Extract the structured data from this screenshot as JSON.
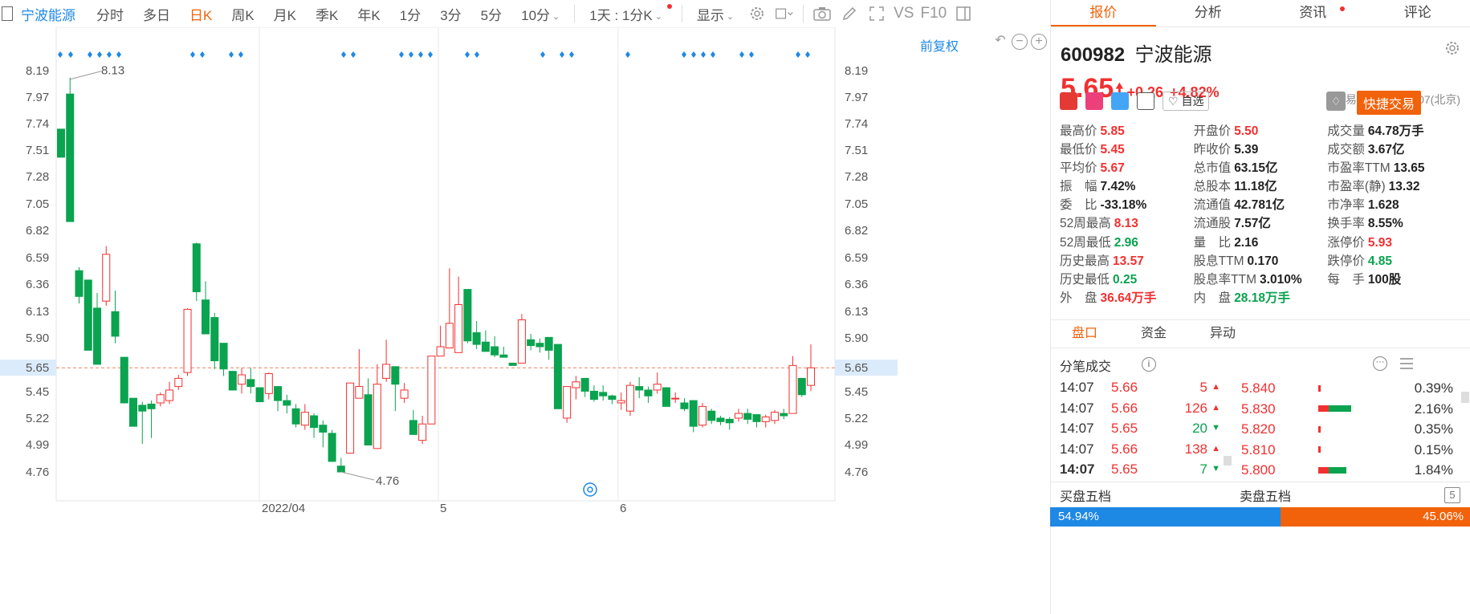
{
  "toolbar": {
    "stock_name": "宁波能源",
    "periods": [
      "分时",
      "多日",
      "日K",
      "周K",
      "月K",
      "季K",
      "年K",
      "1分",
      "3分",
      "5分",
      "10分"
    ],
    "active_period": "日K",
    "multi_day": "1天 : 1分K",
    "display_label": "显示",
    "vs_label": "VS",
    "f10_label": "F10"
  },
  "chart": {
    "adjust_label": "前复权",
    "y_ticks": [
      "8.19",
      "7.97",
      "7.74",
      "7.51",
      "7.28",
      "7.05",
      "6.82",
      "6.59",
      "6.36",
      "6.13",
      "5.90",
      "5.65",
      "5.45",
      "5.22",
      "4.99",
      "4.76"
    ],
    "current_price_tag": "5.65",
    "x_labels": [
      "2022/04",
      "5",
      "6"
    ],
    "high_annotation": "8.13",
    "low_annotation": "4.76",
    "up_color": "#f23030",
    "down_color": "#0aa34f"
  },
  "chart_data": {
    "type": "candlestick",
    "y_axis_ticks": [
      8.19,
      7.97,
      7.74,
      7.51,
      7.28,
      7.05,
      6.82,
      6.59,
      6.36,
      6.13,
      5.9,
      5.65,
      5.45,
      5.22,
      4.99,
      4.76
    ],
    "ylim": [
      4.6,
      8.36
    ],
    "x_tick_labels": [
      "2022/04",
      "5",
      "6"
    ],
    "max_label": 8.13,
    "min_label": 4.76,
    "candles": [
      [
        7.69,
        7.45,
        7.69,
        7.45
      ],
      [
        7.99,
        6.9,
        8.13,
        6.9
      ],
      [
        6.48,
        6.26,
        6.51,
        6.2
      ],
      [
        6.4,
        5.8,
        6.4,
        5.8
      ],
      [
        6.16,
        5.68,
        6.29,
        5.68
      ],
      [
        6.22,
        6.62,
        6.69,
        6.18
      ],
      [
        6.13,
        5.92,
        6.31,
        5.86
      ],
      [
        5.74,
        5.35,
        5.74,
        5.35
      ],
      [
        5.39,
        5.15,
        5.39,
        5.15
      ],
      [
        5.33,
        5.28,
        5.36,
        5.0
      ],
      [
        5.34,
        5.3,
        5.37,
        5.05
      ],
      [
        5.35,
        5.42,
        5.44,
        5.32
      ],
      [
        5.37,
        5.46,
        5.53,
        5.34
      ],
      [
        5.49,
        5.56,
        5.59,
        5.46
      ],
      [
        5.61,
        6.15,
        6.16,
        5.58
      ],
      [
        6.71,
        6.3,
        6.72,
        6.22
      ],
      [
        6.23,
        5.94,
        6.39,
        5.94
      ],
      [
        6.08,
        5.71,
        6.12,
        5.64
      ],
      [
        5.86,
        5.64,
        5.86,
        5.58
      ],
      [
        5.62,
        5.46,
        5.62,
        5.46
      ],
      [
        5.51,
        5.59,
        5.65,
        5.43
      ],
      [
        5.55,
        5.49,
        5.65,
        5.43
      ],
      [
        5.48,
        5.36,
        5.48,
        5.36
      ],
      [
        5.43,
        5.6,
        5.61,
        5.38
      ],
      [
        5.49,
        5.37,
        5.49,
        5.28
      ],
      [
        5.37,
        5.33,
        5.42,
        5.26
      ],
      [
        5.3,
        5.17,
        5.34,
        5.14
      ],
      [
        5.16,
        5.27,
        5.34,
        5.12
      ],
      [
        5.24,
        5.14,
        5.26,
        5.05
      ],
      [
        5.16,
        5.1,
        5.2,
        4.97
      ],
      [
        5.09,
        4.85,
        5.12,
        4.85
      ],
      [
        4.81,
        4.76,
        4.88,
        4.76
      ],
      [
        4.92,
        5.52,
        5.52,
        4.92
      ],
      [
        5.39,
        5.49,
        5.81,
        5.39
      ],
      [
        5.42,
        4.99,
        5.56,
        4.99
      ],
      [
        4.96,
        5.51,
        5.68,
        4.96
      ],
      [
        5.56,
        5.68,
        5.89,
        5.53
      ],
      [
        5.66,
        5.51,
        5.66,
        5.28
      ],
      [
        5.39,
        5.46,
        5.52,
        5.35
      ],
      [
        5.2,
        5.08,
        5.29,
        5.08
      ],
      [
        5.03,
        5.17,
        5.24,
        5.0
      ],
      [
        5.17,
        5.75,
        5.75,
        5.17
      ],
      [
        5.75,
        5.83,
        6.01,
        5.75
      ],
      [
        5.82,
        6.03,
        6.5,
        5.82
      ],
      [
        5.78,
        6.19,
        6.43,
        5.78
      ],
      [
        6.32,
        5.88,
        6.32,
        5.86
      ],
      [
        5.95,
        5.85,
        6.05,
        5.81
      ],
      [
        5.87,
        5.79,
        5.97,
        5.79
      ],
      [
        5.83,
        5.76,
        5.92,
        5.74
      ],
      [
        5.76,
        5.74,
        5.83,
        5.74
      ],
      [
        5.69,
        5.67,
        5.69,
        5.67
      ],
      [
        5.69,
        6.06,
        6.11,
        5.69
      ],
      [
        5.89,
        5.84,
        5.94,
        5.8
      ],
      [
        5.86,
        5.83,
        5.9,
        5.78
      ],
      [
        5.91,
        5.8,
        5.91,
        5.72
      ],
      [
        5.85,
        5.3,
        5.85,
        5.3
      ],
      [
        5.22,
        5.49,
        5.49,
        5.18
      ],
      [
        5.48,
        5.53,
        5.58,
        5.38
      ],
      [
        5.56,
        5.45,
        5.56,
        5.4
      ],
      [
        5.45,
        5.38,
        5.5,
        5.36
      ],
      [
        5.44,
        5.41,
        5.5,
        5.37
      ],
      [
        5.41,
        5.38,
        5.42,
        5.34
      ],
      [
        5.35,
        5.37,
        5.44,
        5.29
      ],
      [
        5.28,
        5.5,
        5.53,
        5.24
      ],
      [
        5.49,
        5.46,
        5.57,
        5.39
      ],
      [
        5.46,
        5.41,
        5.49,
        5.35
      ],
      [
        5.46,
        5.51,
        5.61,
        5.43
      ],
      [
        5.48,
        5.32,
        5.48,
        5.32
      ],
      [
        5.39,
        5.39,
        5.44,
        5.35
      ],
      [
        5.35,
        5.3,
        5.39,
        5.28
      ],
      [
        5.37,
        5.15,
        5.37,
        5.1
      ],
      [
        5.16,
        5.32,
        5.35,
        5.14
      ],
      [
        5.28,
        5.2,
        5.3,
        5.17
      ],
      [
        5.22,
        5.19,
        5.24,
        5.16
      ],
      [
        5.21,
        5.18,
        5.23,
        5.12
      ],
      [
        5.22,
        5.26,
        5.3,
        5.19
      ],
      [
        5.26,
        5.21,
        5.3,
        5.17
      ],
      [
        5.25,
        5.19,
        5.25,
        5.14
      ],
      [
        5.19,
        5.23,
        5.25,
        5.14
      ],
      [
        5.2,
        5.27,
        5.29,
        5.17
      ],
      [
        5.26,
        5.24,
        5.3,
        5.21
      ],
      [
        5.26,
        5.67,
        5.75,
        5.26
      ],
      [
        5.56,
        5.42,
        5.56,
        5.4
      ],
      [
        5.5,
        5.65,
        5.85,
        5.45
      ]
    ]
  },
  "panel": {
    "tabs": [
      "报价",
      "分析",
      "资讯",
      "评论"
    ],
    "active_tab": "报价",
    "code": "600982",
    "name": "宁波能源",
    "price": "5.65",
    "change": "+0.26",
    "pct": "+4.82%",
    "status": "交易中 06/30 14:07(北京)",
    "watch_label": "自选",
    "quick_trade": "快捷交易",
    "stats": [
      [
        [
          "最高价",
          "5.85",
          "red"
        ],
        [
          "开盘价",
          "5.50",
          "red"
        ],
        [
          "成交量",
          "64.78万手",
          "dark"
        ]
      ],
      [
        [
          "最低价",
          "5.45",
          "red"
        ],
        [
          "昨收价",
          "5.39",
          "dark"
        ],
        [
          "成交额",
          "3.67亿",
          "dark"
        ]
      ],
      [
        [
          "平均价",
          "5.67",
          "red"
        ],
        [
          "总市值",
          "63.15亿",
          "dark"
        ],
        [
          "市盈率TTM",
          "13.65",
          "dark"
        ]
      ],
      [
        [
          "振　幅",
          "7.42%",
          "dark"
        ],
        [
          "总股本",
          "11.18亿",
          "dark"
        ],
        [
          "市盈率(静)",
          "13.32",
          "dark"
        ]
      ],
      [
        [
          "委　比",
          "-33.18%",
          "dark"
        ],
        [
          "流通值",
          "42.781亿",
          "dark"
        ],
        [
          "市净率",
          "1.628",
          "dark"
        ]
      ],
      [
        [
          "52周最高",
          "8.13",
          "red"
        ],
        [
          "流通股",
          "7.57亿",
          "dark"
        ],
        [
          "换手率",
          "8.55%",
          "dark"
        ]
      ],
      [
        [
          "52周最低",
          "2.96",
          "green"
        ],
        [
          "量　比",
          "2.16",
          "dark"
        ],
        [
          "涨停价",
          "5.93",
          "red"
        ]
      ],
      [
        [
          "历史最高",
          "13.57",
          "red"
        ],
        [
          "股息TTM",
          "0.170",
          "dark"
        ],
        [
          "跌停价",
          "4.85",
          "green"
        ]
      ],
      [
        [
          "历史最低",
          "0.25",
          "green"
        ],
        [
          "股息率TTM",
          "3.010%",
          "dark"
        ],
        [
          "每　手",
          "100股",
          "dark"
        ]
      ],
      [
        [
          "外　盘",
          "36.64万手",
          "red"
        ],
        [
          "内　盘",
          "28.18万手",
          "green"
        ],
        [
          "",
          "",
          "dark"
        ]
      ]
    ],
    "detail_tabs": [
      "盘口",
      "资金",
      "异动"
    ],
    "ticks_title": "分笔成交",
    "ticks": [
      [
        "14:07",
        "5.66",
        "5",
        "up"
      ],
      [
        "14:07",
        "5.66",
        "126",
        "up"
      ],
      [
        "14:07",
        "5.65",
        "20",
        "down"
      ],
      [
        "14:07",
        "5.66",
        "138",
        "up"
      ],
      [
        "14:07",
        "5.65",
        "7",
        "down"
      ]
    ],
    "book": [
      [
        "5.840",
        "0.39%",
        0.02,
        0.0
      ],
      [
        "5.830",
        "2.16%",
        0.12,
        0.26
      ],
      [
        "5.820",
        "0.35%",
        0.02,
        0.0
      ],
      [
        "5.810",
        "0.15%",
        0.01,
        0.0
      ],
      [
        "5.800",
        "1.84%",
        0.12,
        0.2
      ]
    ],
    "buy_title": "买盘五档",
    "sell_title": "卖盘五档",
    "buy_ratio": "54.94%",
    "sell_ratio": "45.06%"
  }
}
